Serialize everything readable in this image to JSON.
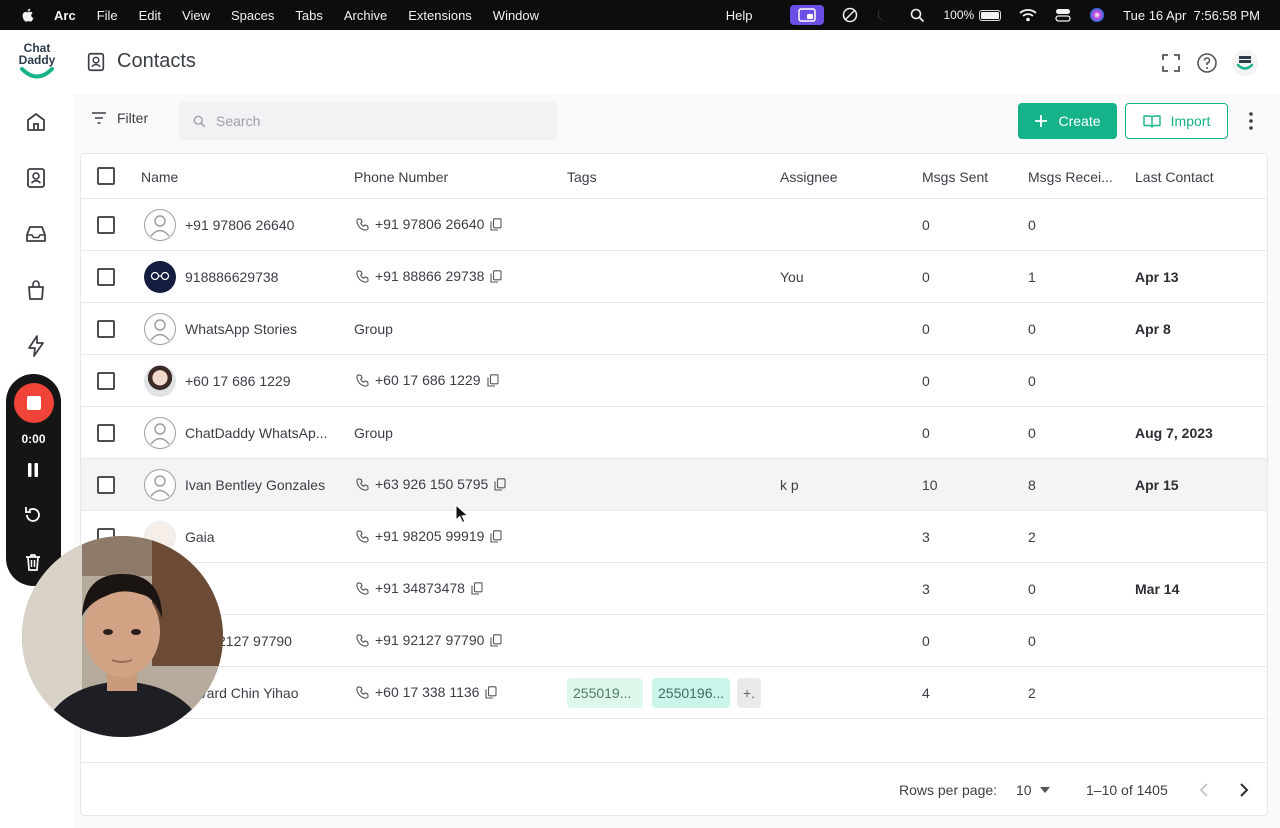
{
  "menubar": {
    "app": "Arc",
    "items": [
      "File",
      "Edit",
      "View",
      "Spaces",
      "Tabs",
      "Archive",
      "Extensions",
      "Window"
    ],
    "help": "Help",
    "battery": "100%",
    "datetime": "Tue 16 Apr  7:56:58 PM"
  },
  "logo": {
    "line1": "Chat",
    "line2": "Daddy"
  },
  "header": {
    "title": "Contacts"
  },
  "toolbar": {
    "filter_label": "Filter",
    "search_placeholder": "Search",
    "create_label": "Create",
    "import_label": "Import"
  },
  "table": {
    "columns": [
      "Name",
      "Phone Number",
      "Tags",
      "Assignee",
      "Msgs Sent",
      "Msgs Recei...",
      "Last Contact"
    ],
    "rows": [
      {
        "name": "+91 97806 26640",
        "phone": "+91 97806 26640",
        "assignee": "",
        "sent": "0",
        "received": "0",
        "last": ""
      },
      {
        "name": "918886629738",
        "phone": "+91 88866 29738",
        "assignee": "You",
        "sent": "0",
        "received": "1",
        "last": "Apr 13"
      },
      {
        "name": "WhatsApp Stories",
        "phone": "Group",
        "assignee": "",
        "sent": "0",
        "received": "0",
        "last": "Apr 8"
      },
      {
        "name": "+60 17 686 1229",
        "phone": "+60 17 686 1229",
        "assignee": "",
        "sent": "0",
        "received": "0",
        "last": ""
      },
      {
        "name": "ChatDaddy WhatsAp...",
        "phone": "Group",
        "assignee": "",
        "sent": "0",
        "received": "0",
        "last": "Aug 7, 2023"
      },
      {
        "name": "Ivan Bentley Gonzales",
        "phone": "+63 926 150 5795",
        "assignee": "k p",
        "sent": "10",
        "received": "8",
        "last": "Apr 15"
      },
      {
        "name": "Gaia",
        "phone": "+91 98205 99919",
        "assignee": "",
        "sent": "3",
        "received": "2",
        "last": ""
      },
      {
        "name": "",
        "phone": "+91 34873478",
        "assignee": "",
        "sent": "3",
        "received": "0",
        "last": "Mar 14"
      },
      {
        "name": "2127 97790",
        "phone": "+91 92127 97790",
        "assignee": "",
        "sent": "0",
        "received": "0",
        "last": ""
      },
      {
        "name": "rvard Chin Yihao",
        "phone": "+60 17 338 1136",
        "assignee": "",
        "sent": "4",
        "received": "2",
        "last": "",
        "tags": [
          "255019...",
          "2550196...",
          "+."
        ]
      }
    ]
  },
  "footer": {
    "rows_per_page_label": "Rows per page:",
    "rows_per_page": "10",
    "range": "1–10 of 1405"
  },
  "recorder": {
    "time": "0:00"
  },
  "colors": {
    "accent": "#16b28a",
    "record": "#f04438",
    "menubar": "#0d0d0d"
  }
}
